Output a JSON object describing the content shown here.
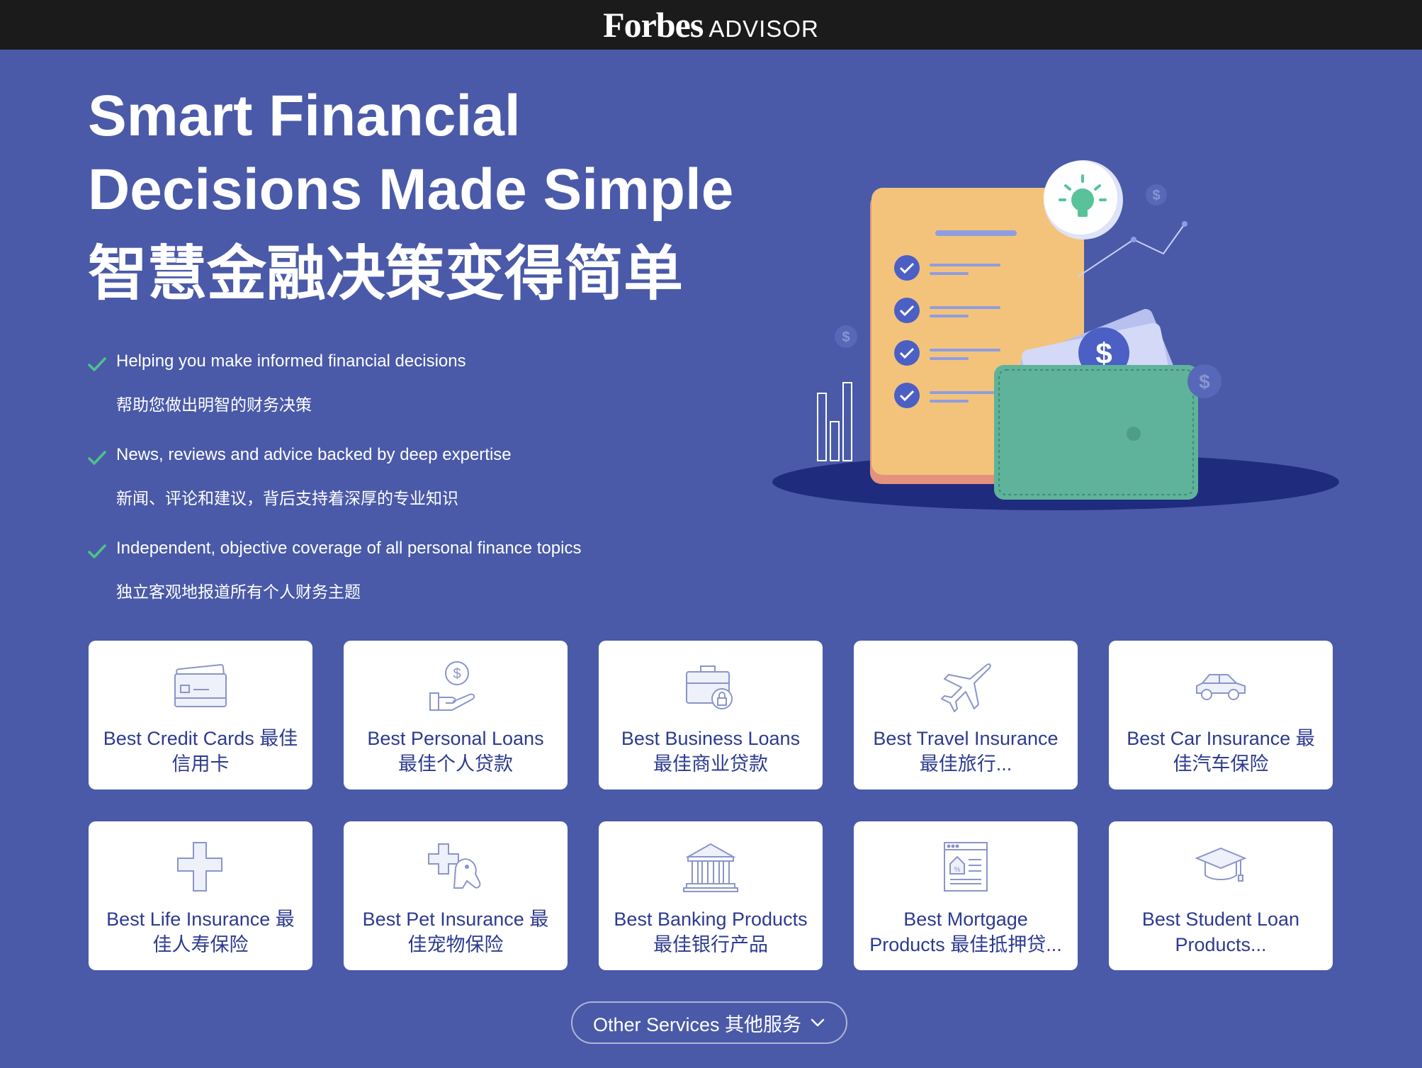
{
  "header": {
    "brand": "Forbes",
    "brand_suffix": "ADVISOR"
  },
  "hero": {
    "title_line1": "Smart Financial",
    "title_line2": "Decisions Made Simple",
    "title_cn": "智慧金融决策变得简单"
  },
  "bullets": [
    {
      "en": "Helping you make informed financial decisions",
      "cn": "帮助您做出明智的财务决策"
    },
    {
      "en": "News, reviews and advice backed by deep expertise",
      "cn": "新闻、评论和建议，背后支持着深厚的专业知识"
    },
    {
      "en": "Independent, objective coverage of all personal finance topics",
      "cn": "独立客观地报道所有个人财务主题"
    }
  ],
  "categories": [
    {
      "label": "Best Credit Cards 最佳信用卡",
      "icon": "credit-card-icon"
    },
    {
      "label": "Best Personal Loans 最佳个人贷款",
      "icon": "hand-coin-icon"
    },
    {
      "label": "Best Business Loans 最佳商业贷款",
      "icon": "briefcase-lock-icon"
    },
    {
      "label": "Best Travel Insurance 最佳旅行...",
      "icon": "airplane-icon"
    },
    {
      "label": "Best Car Insurance 最佳汽车保险",
      "icon": "car-icon"
    },
    {
      "label": "Best Life Insurance 最佳人寿保险",
      "icon": "medical-cross-icon"
    },
    {
      "label": "Best Pet Insurance 最佳宠物保险",
      "icon": "pet-cross-icon"
    },
    {
      "label": "Best Banking Products 最佳银行产品",
      "icon": "bank-icon"
    },
    {
      "label": "Best Mortgage Products 最佳抵押贷...",
      "icon": "mortgage-document-icon"
    },
    {
      "label": "Best Student Loan Products...",
      "icon": "graduation-cap-icon"
    }
  ],
  "more": {
    "label": "Other Services 其他服务",
    "icon": "chevron-down-icon"
  },
  "colors": {
    "background": "#4a5aa8",
    "topbar": "#1b1b1b",
    "check": "#4fc28b",
    "card_text": "#2c3b8f",
    "icon_stroke": "#8a95c9"
  }
}
